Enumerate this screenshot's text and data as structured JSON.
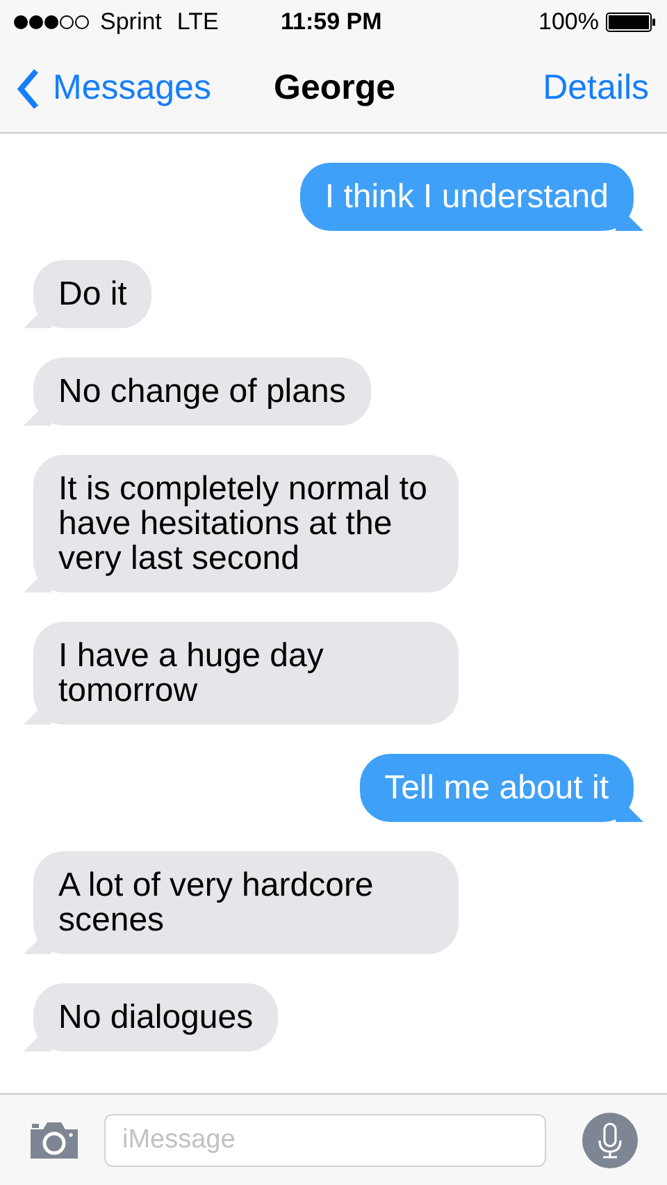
{
  "status_bar": {
    "carrier": "Sprint",
    "network": "LTE",
    "time": "11:59 PM",
    "battery": "100%"
  },
  "nav": {
    "back": "Messages",
    "title": "George",
    "action": "Details"
  },
  "messages": [
    {
      "text": "I think I understand",
      "outgoing": true
    },
    {
      "text": "Do it",
      "outgoing": false
    },
    {
      "text": "No change of plans",
      "outgoing": false
    },
    {
      "text": "It is completely normal to have hesitations at the very last second",
      "outgoing": false
    },
    {
      "text": "I have a huge day tomorrow",
      "outgoing": false
    },
    {
      "text": "Tell me about it",
      "outgoing": true
    },
    {
      "text": "A lot of very hardcore scenes",
      "outgoing": false
    },
    {
      "text": "No dialogues",
      "outgoing": false
    }
  ],
  "composer": {
    "placeholder": "iMessage"
  }
}
